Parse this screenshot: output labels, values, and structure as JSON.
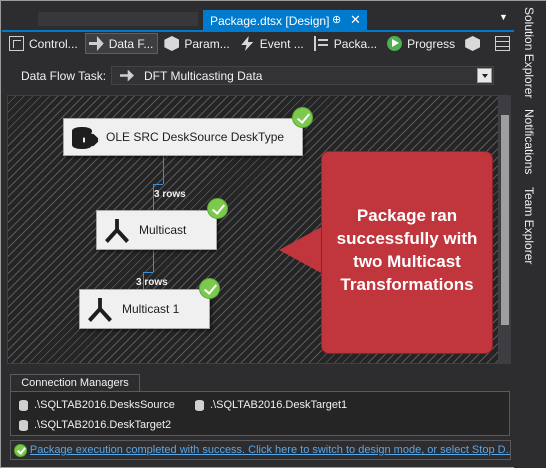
{
  "document_tab": {
    "title": "Package.dtsx [Design]",
    "pin_glyph": "⊕",
    "close_glyph": "✕"
  },
  "designer_tabs": [
    {
      "label": "Control...",
      "icon": "grid-icon",
      "active": false
    },
    {
      "label": "Data F...",
      "icon": "data-flow-icon",
      "active": true
    },
    {
      "label": "Param...",
      "icon": "cube-icon",
      "active": false
    },
    {
      "label": "Event ...",
      "icon": "lightning-icon",
      "active": false
    },
    {
      "label": "Packa...",
      "icon": "tree-icon",
      "active": false
    },
    {
      "label": "Progress",
      "icon": "play-icon",
      "active": false
    }
  ],
  "data_flow_task": {
    "label": "Data Flow Task:",
    "value": "DFT Multicasting Data"
  },
  "nodes": {
    "source": {
      "label": "OLE SRC DeskSource DeskType",
      "status": "success"
    },
    "multicast": {
      "label": "Multicast",
      "status": "success"
    },
    "multicast1": {
      "label": "Multicast 1",
      "status": "success"
    }
  },
  "paths": {
    "path1_rows": "3 rows",
    "path2_rows": "3 rows"
  },
  "callout": {
    "line1": "Package ran",
    "line2": "successfully with",
    "line3": "two Multicast",
    "line4": "Transformations",
    "color": "#c1363d"
  },
  "connection_managers": {
    "tab_label": "Connection Managers",
    "items": [
      ".\\SQLTAB2016.DesksSource",
      ".\\SQLTAB2016.DeskTarget1",
      ".\\SQLTAB2016.DeskTarget2"
    ]
  },
  "status_bar": {
    "message": "Package execution completed with success. Click here to switch to design mode, or select Stop D..."
  },
  "side_panels": [
    "Solution Explorer",
    "Notifications",
    "Team Explorer"
  ],
  "colors": {
    "accent": "#007acc",
    "success": "#7cc94e",
    "path": "#3a8fd9"
  }
}
